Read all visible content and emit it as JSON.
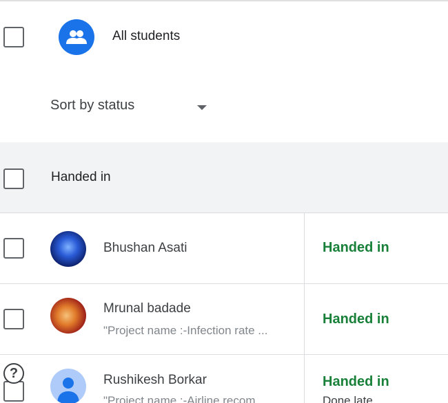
{
  "all_students": {
    "label": "All students",
    "icon": "group-icon"
  },
  "sort": {
    "label": "Sort by status"
  },
  "section": {
    "label": "Handed in"
  },
  "students": [
    {
      "name": "Bhushan Asati",
      "snippet": "",
      "status": "Handed in",
      "substatus": ""
    },
    {
      "name": "Mrunal badade",
      "snippet": "\"Project name :-Infection rate ...",
      "status": "Handed in",
      "substatus": ""
    },
    {
      "name": "Rushikesh Borkar",
      "snippet": "\"Project name :-Airline recom",
      "status": "Handed in",
      "substatus": "Done late"
    }
  ],
  "help": {
    "glyph": "?"
  },
  "colors": {
    "accent": "#1a73e8",
    "status_green": "#188038",
    "header_bg": "#f1f3f4"
  }
}
